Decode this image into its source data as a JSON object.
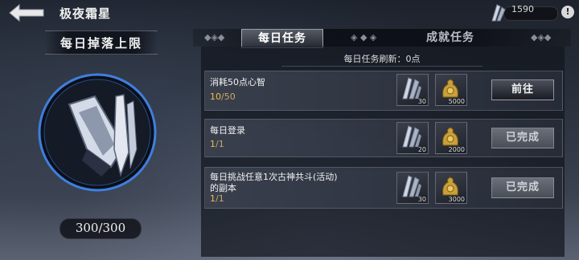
{
  "header": {
    "title": "极夜霜星",
    "currency_amount": "1590",
    "info_label": "!"
  },
  "left_panel": {
    "banner": "每日掉落上限",
    "drop_count": "300/300"
  },
  "tabs": [
    {
      "label": "每日任务",
      "active": true
    },
    {
      "label": "成就任务",
      "active": false
    }
  ],
  "refresh_text": "每日任务刷新：0点",
  "tasks": [
    {
      "name": "消耗50点心智",
      "progress_current": "10",
      "progress_total": "/50",
      "rewards": [
        {
          "icon": "crystal-icon",
          "qty": "30"
        },
        {
          "icon": "gold-coins-icon",
          "qty": "5000"
        }
      ],
      "action": "前往",
      "status": "go"
    },
    {
      "name": "每日登录",
      "progress_current": "1",
      "progress_total": "/1",
      "rewards": [
        {
          "icon": "crystal-icon",
          "qty": "20"
        },
        {
          "icon": "gold-coins-icon",
          "qty": "2000"
        }
      ],
      "action": "已完成",
      "status": "done"
    },
    {
      "name": "每日挑战任意1次古神共斗(活动)",
      "name_line2": "的副本",
      "progress_current": "1",
      "progress_total": "/1",
      "rewards": [
        {
          "icon": "crystal-icon",
          "qty": "30"
        },
        {
          "icon": "gold-coins-icon",
          "qty": "3000"
        }
      ],
      "action": "已完成",
      "status": "done"
    }
  ],
  "colors": {
    "progress_current": "#e8c04a",
    "emblem_ring": "#3f7fe0"
  }
}
